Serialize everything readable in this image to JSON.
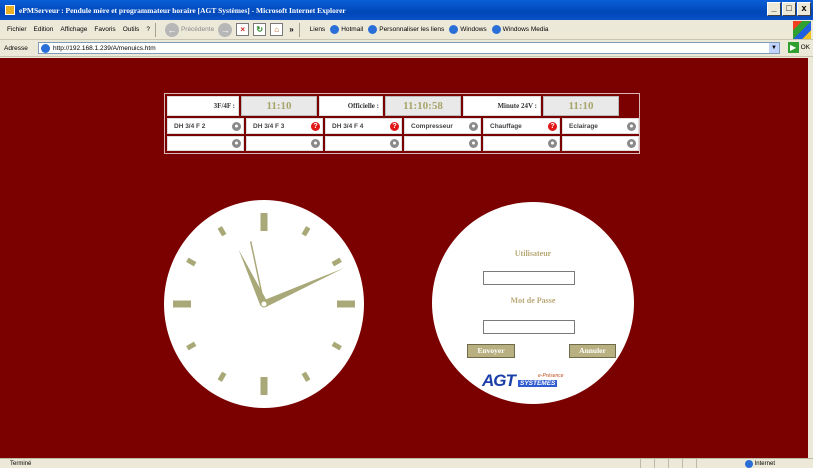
{
  "window": {
    "title": "ePMServeur : Pendule mère et programmateur horaire [AGT Systèmes] - Microsoft Internet Explorer",
    "controls": [
      "_",
      "□",
      "x"
    ]
  },
  "menubar": {
    "items": [
      "Fichier",
      "Edition",
      "Affichage",
      "Favoris",
      "Outils",
      "?"
    ],
    "back_label": "Précédente",
    "links_label": "Liens",
    "links": [
      "Hotmail",
      "Personnaliser les liens",
      "Windows",
      "Windows Media"
    ]
  },
  "address": {
    "label": "Adresse",
    "url": "http://192.168.1.239/A/menuics.htm",
    "go_label": "OK"
  },
  "panel": {
    "row1": [
      {
        "label": "3F/4F :",
        "value": "11:10"
      },
      {
        "label": "Officielle :",
        "value": "11:10:58"
      },
      {
        "label": "Minute 24V :",
        "value": "11:10"
      }
    ],
    "row2": [
      {
        "label": "DH 3/4 F 2",
        "status": "grey"
      },
      {
        "label": "DH 3/4 F 3",
        "status": "red"
      },
      {
        "label": "DH 3/4 F 4",
        "status": "red"
      },
      {
        "label": "Compresseur",
        "status": "grey"
      },
      {
        "label": "Chauffage",
        "status": "red"
      },
      {
        "label": "Eclairage",
        "status": "grey"
      }
    ],
    "row3": [
      {
        "label": "",
        "status": "grey"
      },
      {
        "label": "",
        "status": "grey"
      },
      {
        "label": "",
        "status": "grey"
      },
      {
        "label": "",
        "status": "grey"
      },
      {
        "label": "",
        "status": "grey"
      },
      {
        "label": "",
        "status": "grey"
      }
    ],
    "colors": {
      "active": "#e01818",
      "inactive": "#8a8a8a",
      "time_text": "#a8a56a"
    }
  },
  "clock": {
    "hours": 11,
    "minutes": 10,
    "seconds": 58,
    "face_color": "#ffffff",
    "hand_color": "#a8a878"
  },
  "login": {
    "user_label": "Utilisateur",
    "pass_label": "Mot de Passe",
    "user_value": "",
    "pass_value": "",
    "submit_label": "Envoyer",
    "cancel_label": "Annuler"
  },
  "logo": {
    "mark": "AGT",
    "sub": "e-Présence",
    "box": "SYSTEMES"
  },
  "statusbar": {
    "status": "Terminé",
    "zone": "Internet"
  },
  "theme": {
    "page_background": "#7b0000",
    "button_color": "#b8b080"
  }
}
